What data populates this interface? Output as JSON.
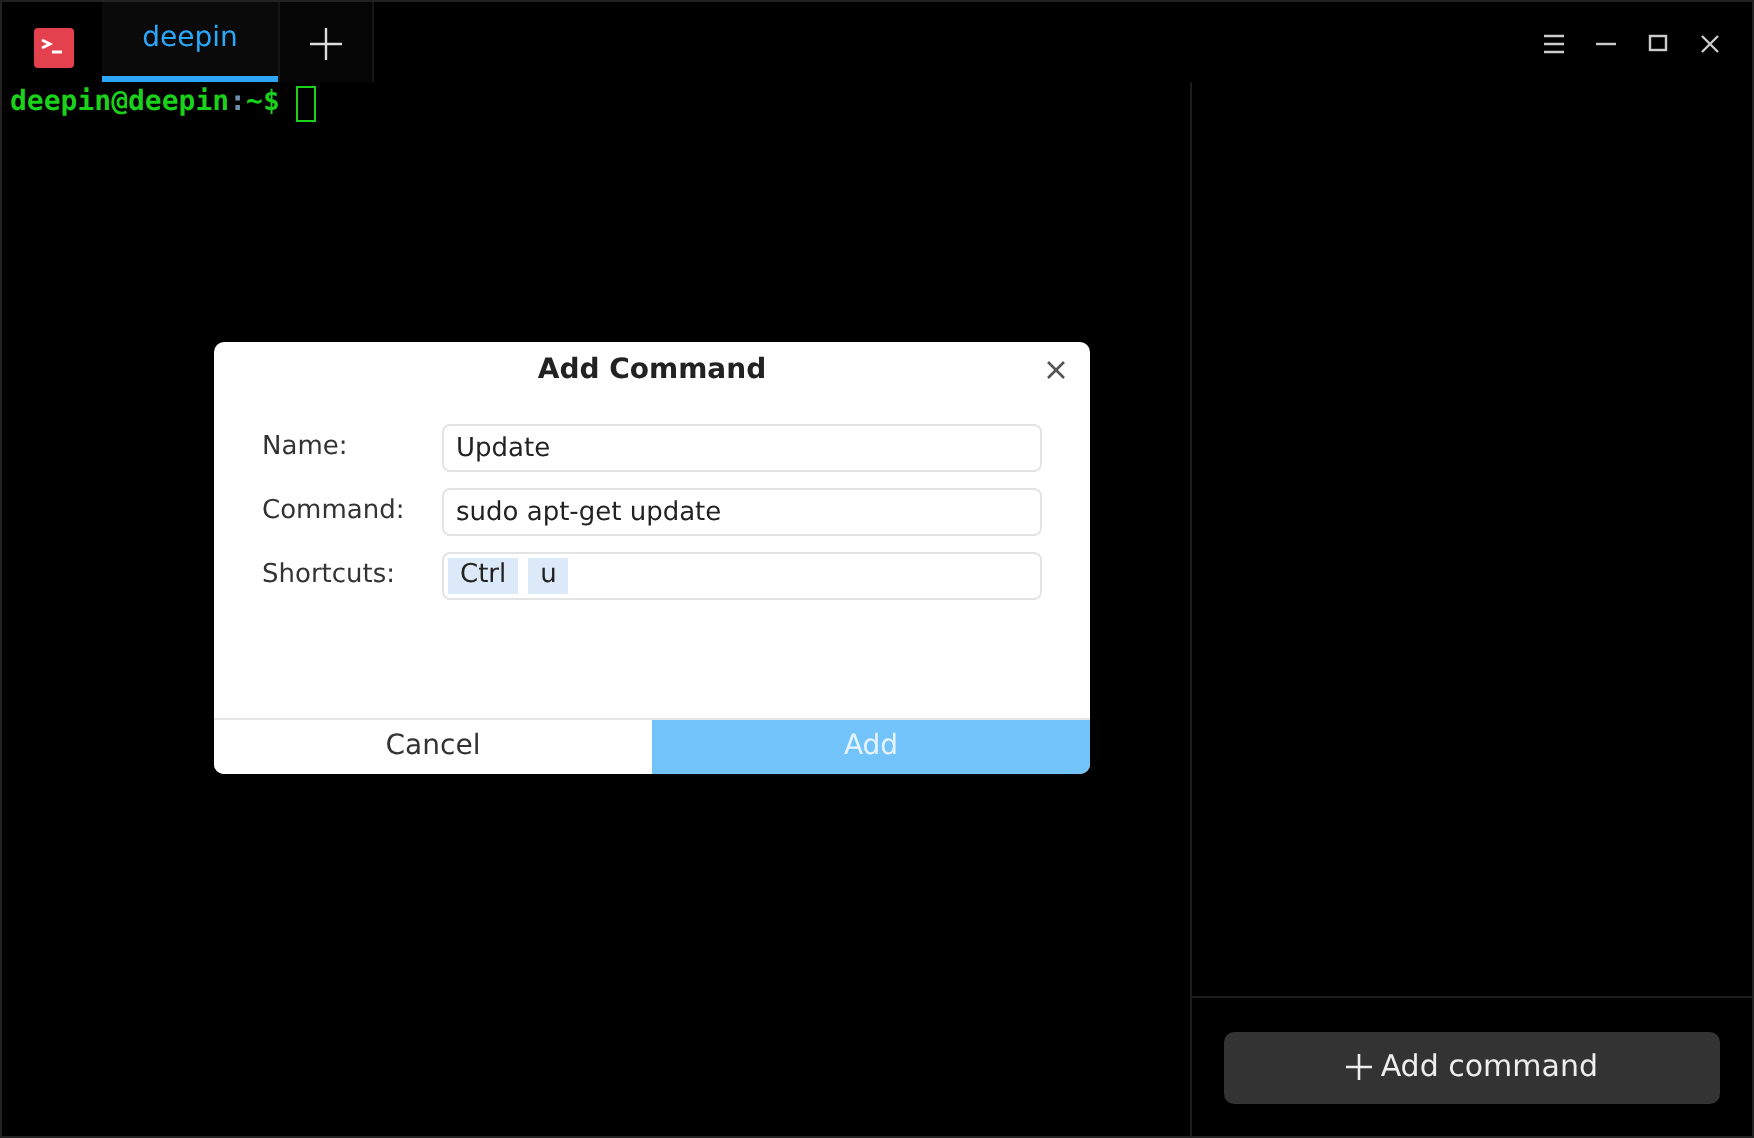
{
  "tabs": [
    {
      "label": "deepin",
      "selected": true
    }
  ],
  "terminal": {
    "prompt": [
      {
        "text": "deepin@deepin",
        "color": "#19d219"
      },
      {
        "text": ":",
        "color": "#6b8fa8"
      },
      {
        "text": "~$",
        "color": "#19d219"
      }
    ]
  },
  "dialog": {
    "title": "Add Command",
    "fields": [
      {
        "kind": "text",
        "label": "Name:",
        "value": "Update"
      },
      {
        "kind": "text",
        "label": "Command:",
        "value": "sudo apt-get update"
      },
      {
        "kind": "shortcut",
        "label": "Shortcuts:",
        "keys": [
          "Ctrl",
          "u"
        ]
      }
    ],
    "buttons": [
      {
        "kind": "secondary",
        "label": "Cancel"
      },
      {
        "kind": "primary",
        "label": "Add"
      }
    ]
  },
  "side_panel": {
    "add_button": "Add command"
  }
}
